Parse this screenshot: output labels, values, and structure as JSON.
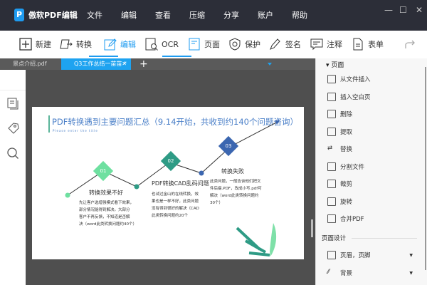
{
  "app": {
    "logo": "P",
    "name": "傲软PDF编辑"
  },
  "menu": [
    "文件",
    "编辑",
    "查看",
    "压缩",
    "分享",
    "账户",
    "帮助"
  ],
  "window": {
    "minimize": "—",
    "maximize": "☐",
    "close": "✕"
  },
  "toolbar": [
    {
      "label": "新建"
    },
    {
      "label": "转换"
    },
    {
      "label": "编辑"
    },
    {
      "label": "OCR"
    },
    {
      "label": "页面"
    },
    {
      "label": "保护"
    },
    {
      "label": "签名"
    },
    {
      "label": "注释"
    },
    {
      "label": "表单"
    }
  ],
  "tabs": [
    {
      "label": "景点介绍.pdf"
    },
    {
      "label": "Q3工作总结一苗苗 *",
      "close": "✕"
    }
  ],
  "add_tab": "+",
  "accent": "#1e9bf0",
  "slide": {
    "title": "PDF转换遇到主要问题汇总（9.14开始，共收到约140个问题咨询）",
    "subtitle": "Please enter the title",
    "steps": [
      {
        "num": "01",
        "color": "#6ee0a0",
        "heading": "转换效果不好",
        "text": [
          "先让客户选增强模式看下效果，",
          "部分情况能得到解决。大部分",
          "客户不再反馈，不知道是否解",
          "决（word此类转换问题约40个）"
        ]
      },
      {
        "num": "02",
        "color": "#2e9b85",
        "heading": "PDF转换CAD乱码问题",
        "text": [
          "也试过金山的在线转换，效",
          "果也是一样不好，此类问题",
          "没有得到很好的解决（CAD",
          "此类转换问题约20个"
        ]
      },
      {
        "num": "03",
        "color": "#3b66b0",
        "heading": "转换失败",
        "text": [
          "此类问题，一般告诉他们把文",
          "件后缀.PDF，改成小写.pdf可",
          "解决（word此类转换问题约",
          "30个）"
        ]
      }
    ]
  },
  "panel": {
    "section1": "页面",
    "items": [
      "从文件插入",
      "插入空白页",
      "删除",
      "提取",
      "替换",
      "分割文件",
      "裁剪",
      "旋转",
      "合并PDF"
    ],
    "section2": "页面设计",
    "design_items": [
      "页眉，页脚",
      "背景"
    ]
  }
}
